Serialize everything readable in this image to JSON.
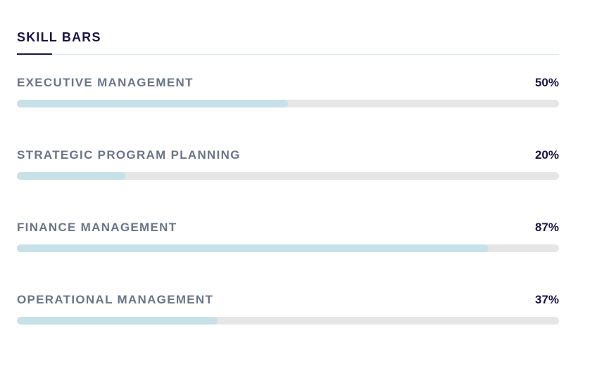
{
  "section": {
    "title": "SKILL BARS"
  },
  "colors": {
    "title": "#1a1446",
    "label": "#6b7489",
    "track": "#e6e6e6",
    "fill": "#c8e1e8"
  },
  "skills": [
    {
      "label": "EXECUTIVE MANAGEMENT",
      "value_text": "50%",
      "percent": 50
    },
    {
      "label": "STRATEGIC PROGRAM PLANNING",
      "value_text": "20%",
      "percent": 20
    },
    {
      "label": "FINANCE MANAGEMENT",
      "value_text": "87%",
      "percent": 87
    },
    {
      "label": "OPERATIONAL MANAGEMENT",
      "value_text": "37%",
      "percent": 37
    }
  ]
}
